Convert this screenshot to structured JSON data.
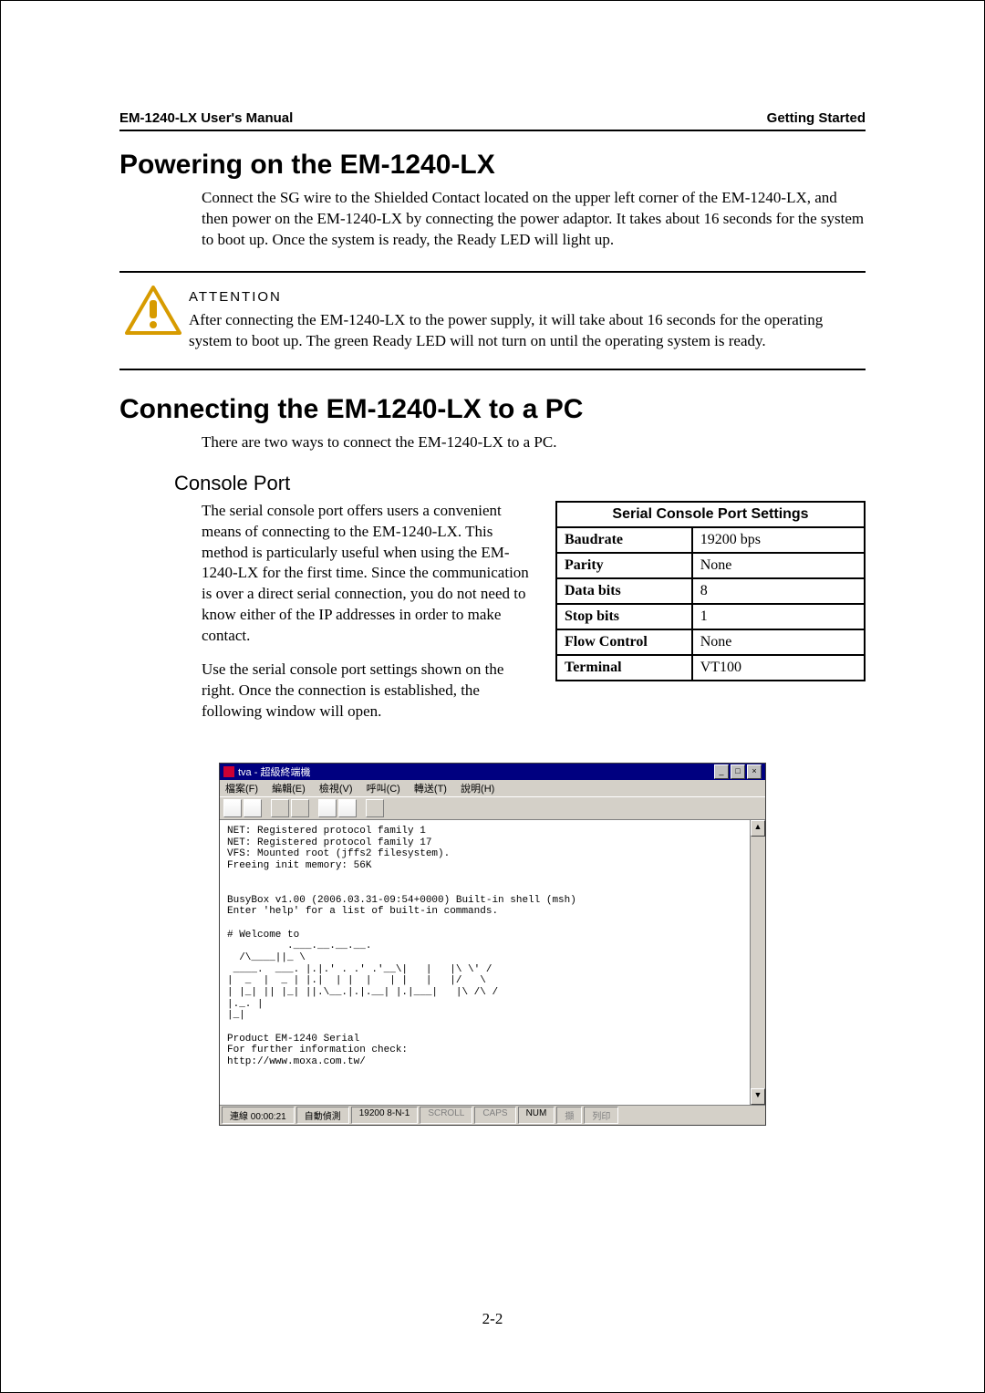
{
  "header": {
    "left": "EM-1240-LX User's Manual",
    "right": "Getting Started"
  },
  "section1": {
    "title": "Powering on the EM-1240-LX",
    "para": "Connect the SG wire to the Shielded Contact located on the upper left corner of the EM-1240-LX, and then power on the EM-1240-LX by connecting the power adaptor. It takes about 16 seconds for the system to boot up. Once the system is ready, the Ready LED will light up."
  },
  "attention": {
    "title": "ATTENTION",
    "body": "After connecting the EM-1240-LX to the power supply, it will take about 16 seconds for the operating system to boot up. The green Ready LED will not turn on until the operating system is ready."
  },
  "section2": {
    "title": "Connecting the EM-1240-LX to a PC",
    "para": "There are two ways to connect the EM-1240-LX to a PC."
  },
  "console": {
    "title": "Console Port",
    "para1": "The serial console port offers users a convenient means of connecting to the EM-1240-LX. This method is particularly useful when using the EM-1240-LX for the first time. Since the communication is over a direct serial connection, you do not need to know either of the IP addresses in order to make contact.",
    "para2": "Use the serial console port settings shown on the right. Once the connection is established, the following window will open."
  },
  "settings": {
    "title": "Serial Console Port Settings",
    "rows": [
      {
        "label": "Baudrate",
        "value": "19200 bps"
      },
      {
        "label": "Parity",
        "value": "None"
      },
      {
        "label": "Data bits",
        "value": "8"
      },
      {
        "label": "Stop bits",
        "value": "1"
      },
      {
        "label": "Flow Control",
        "value": "None"
      },
      {
        "label": "Terminal",
        "value": "VT100"
      }
    ]
  },
  "terminal": {
    "title": "tva - 超級終端機",
    "menu": [
      "檔案(F)",
      "編輯(E)",
      "檢視(V)",
      "呼叫(C)",
      "轉送(T)",
      "說明(H)"
    ],
    "body": "NET: Registered protocol family 1\nNET: Registered protocol family 17\nVFS: Mounted root (jffs2 filesystem).\nFreeing init memory: 56K\n\n\nBusyBox v1.00 (2006.03.31-09:54+0000) Built-in shell (msh)\nEnter 'help' for a list of built-in commands.\n\n# Welcome to\n          .___.__.__.__.\n  /\\____||_ \\\n ____.  ___. |.|.' . .' .'__\\|   |   |\\ \\' /\n|  _  |  _ | |.|  | |  |   | |   |   |/   \\\n| |_| || |_| ||.\\__.|.|.__| |.|___|   |\\ /\\ /\n|._. |\n|_|\n\nProduct EM-1240 Serial\nFor further information check:\nhttp://www.moxa.com.tw/\n",
    "status": {
      "time": "連線 00:00:21",
      "detect": "自動偵測",
      "conn": "19200 8-N-1",
      "scroll": "SCROLL",
      "caps": "CAPS",
      "num": "NUM",
      "cap": "擷",
      "print": "列印"
    }
  },
  "pagenum": "2-2"
}
